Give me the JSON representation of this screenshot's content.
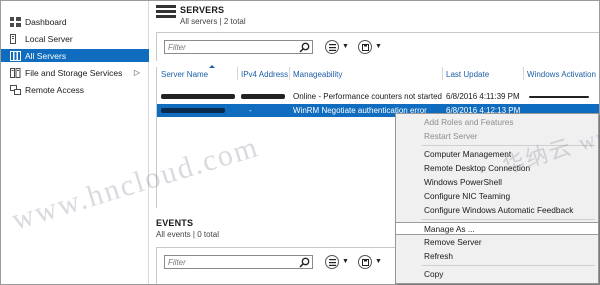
{
  "sidebar": {
    "items": [
      {
        "label": "Dashboard",
        "icon": "dashboard-icon"
      },
      {
        "label": "Local Server",
        "icon": "local-server-icon"
      },
      {
        "label": "All Servers",
        "icon": "all-servers-icon"
      },
      {
        "label": "File and Storage Services",
        "icon": "file-storage-icon"
      },
      {
        "label": "Remote Access",
        "icon": "remote-access-icon"
      }
    ],
    "active_index": 2
  },
  "servers": {
    "title": "SERVERS",
    "subtitle": "All servers | 2 total",
    "filter_placeholder": "Filter",
    "columns": [
      "Server Name",
      "IPv4 Address",
      "Manageability",
      "Last Update",
      "Windows Activation"
    ],
    "rows": [
      {
        "ipv4": "",
        "manageability": "Online - Performance counters not started",
        "last_update": "6/8/2016 4:11:39 PM",
        "activation": ""
      },
      {
        "ipv4": "-",
        "manageability": "WinRM Negotiate authentication error",
        "last_update": "6/8/2016 4:12:13 PM",
        "activation": ""
      }
    ]
  },
  "events": {
    "title": "EVENTS",
    "subtitle": "All events | 0 total",
    "filter_placeholder": "Filter"
  },
  "context_menu": {
    "items": [
      {
        "label": "Add Roles and Features",
        "enabled": false
      },
      {
        "label": "Restart Server",
        "enabled": false
      },
      {
        "label": "Computer Management",
        "enabled": true
      },
      {
        "label": "Remote Desktop Connection",
        "enabled": true
      },
      {
        "label": "Windows PowerShell",
        "enabled": true
      },
      {
        "label": "Configure NIC Teaming",
        "enabled": true
      },
      {
        "label": "Configure Windows Automatic Feedback",
        "enabled": true
      },
      {
        "label": "Manage As ...",
        "enabled": true
      },
      {
        "label": "Remove Server",
        "enabled": true
      },
      {
        "label": "Refresh",
        "enabled": true
      },
      {
        "label": "Copy",
        "enabled": true
      }
    ],
    "hovered_index": 7
  },
  "watermark": {
    "left": "www.hncloud.com",
    "right": "华纳云 ww"
  },
  "colors": {
    "accent": "#0f6cbf",
    "header_link": "#1f5fa8",
    "menu_bg": "#f0f0f0"
  }
}
